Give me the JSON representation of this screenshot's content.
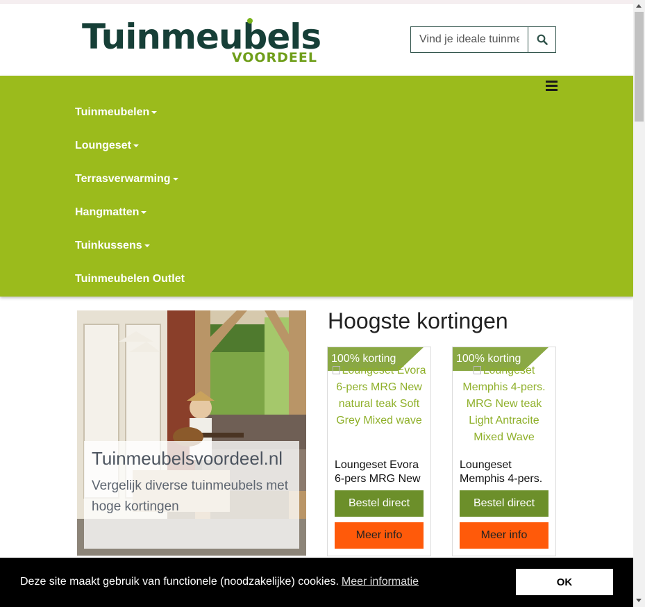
{
  "header": {
    "logo_main": "Tuinmeubels",
    "logo_sub": "VOORDEEL",
    "search_placeholder": "Vind je ideale tuinmeubel",
    "search_icon": "search-icon"
  },
  "nav": {
    "menu_icon": "hamburger-icon",
    "items": [
      {
        "label": "Tuinmeubelen",
        "dropdown": true
      },
      {
        "label": "Loungeset",
        "dropdown": true
      },
      {
        "label": "Terrasverwarming",
        "dropdown": true
      },
      {
        "label": "Hangmatten",
        "dropdown": true
      },
      {
        "label": "Tuinkussens",
        "dropdown": true
      },
      {
        "label": "Tuinmeubelen Outlet",
        "dropdown": false
      }
    ]
  },
  "hero": {
    "title": "Tuinmeubelsvoordeel.nl",
    "subtitle": "Vergelijk diverse tuinmeubels met hoge kortingen"
  },
  "offers": {
    "title": "Hoogste kortingen",
    "products": [
      {
        "badge": "100% korting",
        "image_alt": "Loungeset Evora 6-pers MRG New natural teak Soft Grey Mixed wave",
        "name": "Loungeset Evora 6-pers MRG New",
        "order_label": "Bestel direct",
        "info_label": "Meer info"
      },
      {
        "badge": "100% korting",
        "image_alt": "Loungeset Memphis 4-pers. MRG New teak Light Antracite Mixed Wave",
        "name": "Loungeset Memphis 4-pers.",
        "order_label": "Bestel direct",
        "info_label": "Meer info"
      }
    ]
  },
  "cookie": {
    "text": "Deze site maakt gebruik van functionele (noodzakelijke) cookies.",
    "link": "Meer informatie",
    "ok": "OK"
  },
  "colors": {
    "brand_dark": "#163f37",
    "brand_green": "#9bbb1c",
    "order_button": "#6c8f2a",
    "info_button": "#ff5a0a",
    "ribbon": "#8aa844"
  }
}
